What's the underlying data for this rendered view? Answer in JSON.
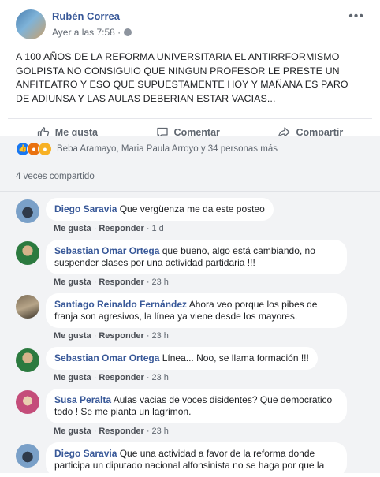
{
  "post": {
    "author": "Rubén Correa",
    "time": "Ayer a las 7:58 ·",
    "more_icon": "ellipsis-icon",
    "text": "A 100 AÑOS DE LA REFORMA UNIVERSITARIA EL ANTIRRFORMISMO GOLPISTA NO CONSIGUIO QUE NINGUN PROFESOR LE PRESTE UN ANFITEATRO Y ESO QUE SUPUESTAMENTE HOY Y MAÑANA ES PARO DE ADIUNSA Y LAS AULAS DEBERIAN ESTAR VACIAS..."
  },
  "actions": {
    "like": "Me gusta",
    "comment": "Comentar",
    "share": "Compartir"
  },
  "reactions": {
    "icons": [
      "like-reaction-icon",
      "angry-reaction-icon",
      "wow-reaction-icon"
    ],
    "text": "Beba Aramayo, Maria Paula Arroyo y 34 personas más"
  },
  "shared_text": "4 veces compartido",
  "comments": [
    {
      "name": "Diego Saravia",
      "text": "Que vergüenza me da este posteo",
      "like": "Me gusta",
      "reply": "Responder",
      "time": "1 d"
    },
    {
      "name": "Sebastian Omar Ortega",
      "text": "que bueno, algo está cambiando, no suspender clases por una actividad partidaria !!!",
      "like": "Me gusta",
      "reply": "Responder",
      "time": "23 h"
    },
    {
      "name": "Santiago Reinaldo Fernández",
      "text": "Ahora veo porque los pibes de franja son agresivos, la línea ya viene desde los mayores.",
      "like": "Me gusta",
      "reply": "Responder",
      "time": "23 h"
    },
    {
      "name": "Sebastian Omar Ortega",
      "text": "Línea... Noo, se llama formación !!!",
      "like": "Me gusta",
      "reply": "Responder",
      "time": "23 h"
    },
    {
      "name": "Susa Peralta",
      "text": "Aulas vacias de voces disidentes? Que democratico todo ! Se me pianta un lagrimon.",
      "like": "Me gusta",
      "reply": "Responder",
      "time": "23 h"
    },
    {
      "name": "Diego Saravia",
      "text": "Que una actividad a favor de la reforma donde participa un diputado nacional alfonsinista no se haga por que la"
    }
  ]
}
